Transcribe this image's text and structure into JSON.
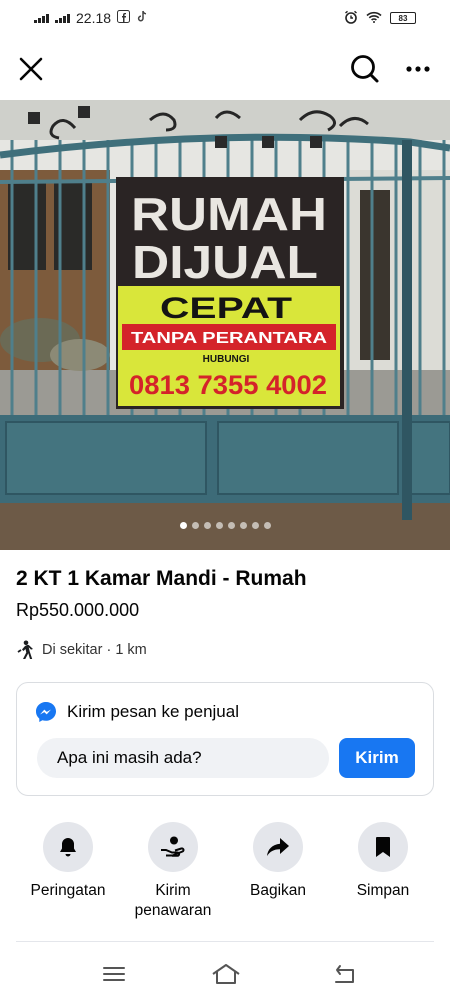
{
  "status_bar": {
    "time": "22.18",
    "battery": "83"
  },
  "header": {
    "icons": [
      "close-icon",
      "search-icon",
      "more-icon"
    ]
  },
  "photo": {
    "sign_line1": "RUMAH",
    "sign_line2": "DIJUAL",
    "sign_line3": "CEPAT",
    "sign_line4": "TANPA PERANTARA",
    "sign_line5": "HUBUNGI",
    "sign_phone": "0813 7355 4002",
    "page_count": 8,
    "current_page": 1
  },
  "listing": {
    "title": "2 KT 1 Kamar Mandi - Rumah",
    "price": "Rp550.000.000",
    "distance": "Di sekitar · 1 km"
  },
  "message": {
    "heading": "Kirim pesan ke penjual",
    "input_value": "Apa ini masih ada?",
    "send_label": "Kirim"
  },
  "actions": {
    "alert": "Peringatan",
    "offer": "Kirim penawaran",
    "share": "Bagikan",
    "save": "Simpan"
  },
  "colors": {
    "accent": "#1877f2",
    "circle_bg": "#e4e6eb",
    "sign_yellow": "#d9e63a",
    "sign_red": "#d4232a"
  }
}
